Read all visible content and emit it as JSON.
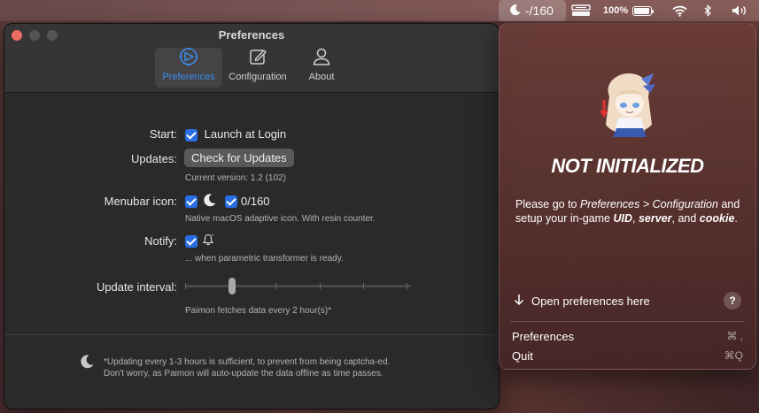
{
  "menubar": {
    "resin": "-/160",
    "battery": "100%"
  },
  "window": {
    "title": "Preferences",
    "tabs": [
      {
        "label": "Preferences",
        "icon": "gauge-icon",
        "active": true
      },
      {
        "label": "Configuration",
        "icon": "edit-icon",
        "active": false
      },
      {
        "label": "About",
        "icon": "person-icon",
        "active": false
      }
    ],
    "start_label": "Start:",
    "launch_label": "Launch at Login",
    "updates_label": "Updates:",
    "check_updates": "Check for Updates",
    "current_version": "Current version: 1.2 (102)",
    "menubar_icon_label": "Menubar icon:",
    "resin_count": "0/160",
    "menubar_icon_note": "Native macOS adaptive icon. With resin counter.",
    "notify_label": "Notify:",
    "notify_note": "... when parametric transformer is ready.",
    "update_interval_label": "Update interval:",
    "update_interval_value": 2,
    "interval_note": "Paimon fetches data every 2 hour(s)*",
    "footnote_line1": "*Updating every 1-3 hours is sufficient, to prevent from being captcha-ed.",
    "footnote_line2": "Don't worry, as Paimon will auto-update the data offline as time passes."
  },
  "popover": {
    "status": "NOT INITIALIZED",
    "msg_1": "Please go to ",
    "msg_path": "Preferences > Configuration",
    "msg_2": " and setup your in-game ",
    "msg_uid": "UID",
    "msg_3": ", ",
    "msg_server": "server",
    "msg_4": ", and ",
    "msg_cookie": "cookie",
    "msg_5": ".",
    "open_prefs": "Open preferences here",
    "help": "?",
    "menu": [
      {
        "label": "Preferences",
        "shortcut": "⌘ ,"
      },
      {
        "label": "Quit",
        "shortcut": "⌘Q"
      }
    ]
  },
  "colors": {
    "accent": "#2a6ee6",
    "tab_active": "#3b8cf0",
    "close": "#ed6a5e"
  }
}
